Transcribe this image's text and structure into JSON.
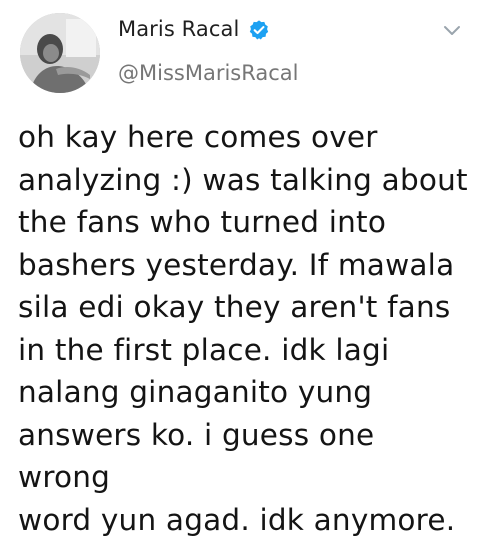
{
  "author": {
    "display_name": "Maris Racal",
    "handle": "@MissMarisRacal",
    "verified": true,
    "verified_color": "#1da1f2"
  },
  "tweet": {
    "text": "oh kay here comes over\nanalyzing :) was talking about\nthe fans who turned into\nbashers yesterday. If mawala\nsila edi okay they aren't fans\nin the first place. idk lagi\nnalang ginaganito yung\nanswers ko. i guess one wrong\nword yun agad. idk anymore."
  },
  "icons": {
    "avatar": "avatar",
    "verified": "verified-badge-icon",
    "menu": "chevron-down-icon"
  }
}
